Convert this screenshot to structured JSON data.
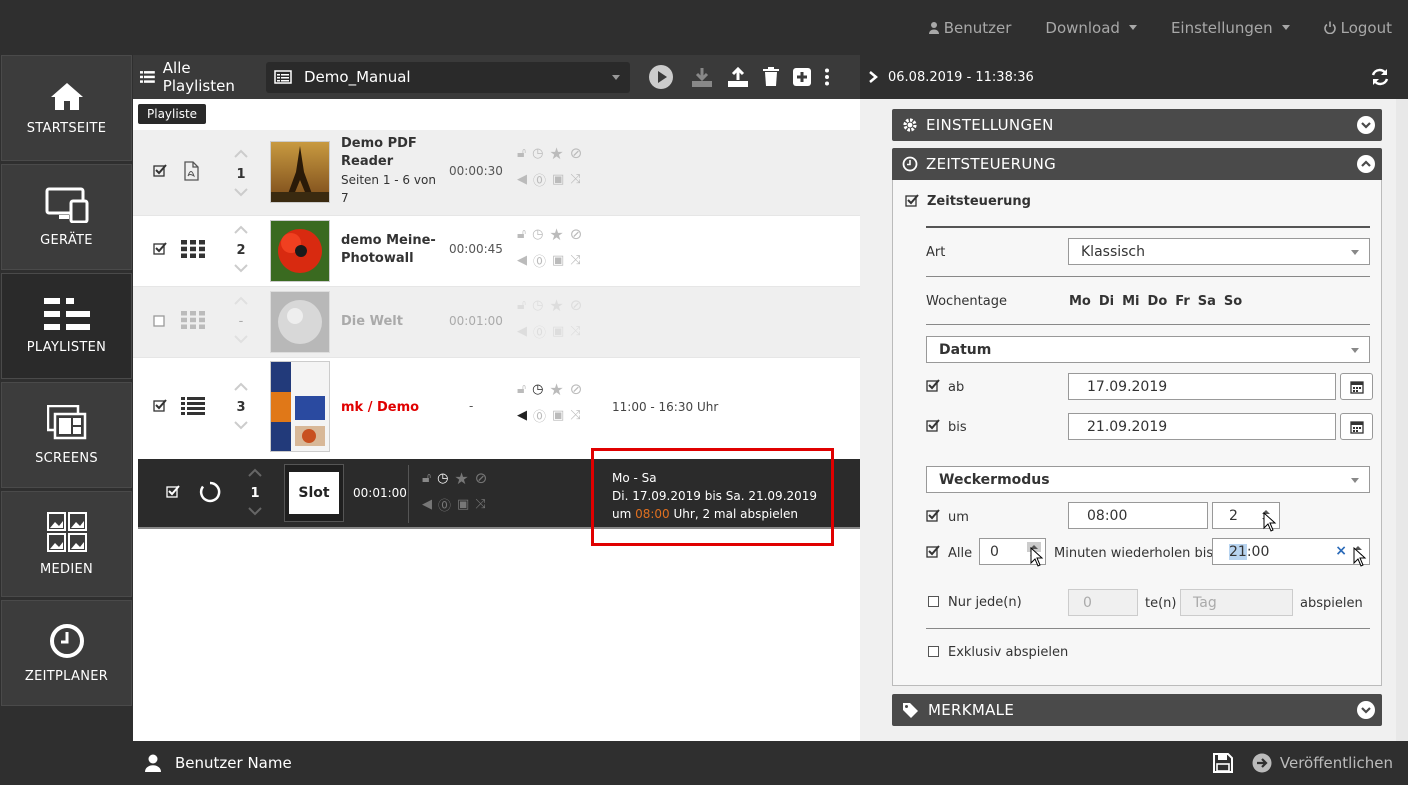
{
  "topnav": {
    "user": "Benutzer",
    "download": "Download",
    "settings": "Einstellungen",
    "logout": "Logout"
  },
  "sidebar": [
    {
      "label": "STARTSEITE",
      "icon": "home-icon"
    },
    {
      "label": "GERÄTE",
      "icon": "devices-icon"
    },
    {
      "label": "PLAYLISTEN",
      "icon": "playlists-icon"
    },
    {
      "label": "SCREENS",
      "icon": "screens-icon"
    },
    {
      "label": "MEDIEN",
      "icon": "media-icon"
    },
    {
      "label": "ZEITPLANER",
      "icon": "clock-icon"
    }
  ],
  "toolbar": {
    "all_playlists": "Alle Playlisten",
    "selected_playlist": "Demo_Manual",
    "tooltip": "Playliste"
  },
  "rows": [
    {
      "num": "1",
      "title": "Demo PDF Reader",
      "sub": "Seiten 1 - 6 von 7",
      "duration": "00:00:30",
      "schedule": ""
    },
    {
      "num": "2",
      "title": "demo Meine-Photowall",
      "sub": "",
      "duration": "00:00:45",
      "schedule": ""
    },
    {
      "num": "-",
      "title": "Die Welt",
      "sub": "",
      "duration": "00:01:00",
      "schedule": ""
    },
    {
      "num": "3",
      "title": "mk / Demo",
      "sub": "",
      "duration": "-",
      "schedule": "11:00 - 16:30 Uhr"
    }
  ],
  "slot": {
    "num": "1",
    "label": "Slot",
    "duration": "00:01:00",
    "sched1": "Mo - Sa",
    "sched2": "Di. 17.09.2019 bis Sa. 21.09.2019",
    "sched3a": "um ",
    "sched3time": "08:00",
    "sched3b": " Uhr, 2 mal abspielen"
  },
  "right": {
    "timestamp": "06.08.2019 - 11:38:36",
    "acc_settings": "EINSTELLUNGEN",
    "acc_time": "ZEITSTEUERUNG",
    "acc_features": "MERKMALE",
    "zeitsteuerung": "Zeitsteuerung",
    "art_label": "Art",
    "art_value": "Klassisch",
    "weekday_label": "Wochentage",
    "weekdays": [
      "Mo",
      "Di",
      "Mi",
      "Do",
      "Fr",
      "Sa",
      "So"
    ],
    "datum": "Datum",
    "ab_label": "ab",
    "ab_value": "17.09.2019",
    "bis_label": "bis",
    "bis_value": "21.09.2019",
    "wecker": "Weckermodus",
    "um_label": "um",
    "um_value": "08:00",
    "count_value": "2",
    "alle_label": "Alle",
    "alle_value": "0",
    "minuten": "Minuten wiederholen bis",
    "until_hour": "21",
    "until_min": ":00",
    "nur_label": "Nur jede(n)",
    "nur_value": "0",
    "ten": "te(n)",
    "tag_placeholder": "Tag",
    "abspielen": "abspielen",
    "exklusiv": "Exklusiv abspielen"
  },
  "bottom": {
    "user_name": "Benutzer Name",
    "publish": "Veröffentlichen"
  }
}
